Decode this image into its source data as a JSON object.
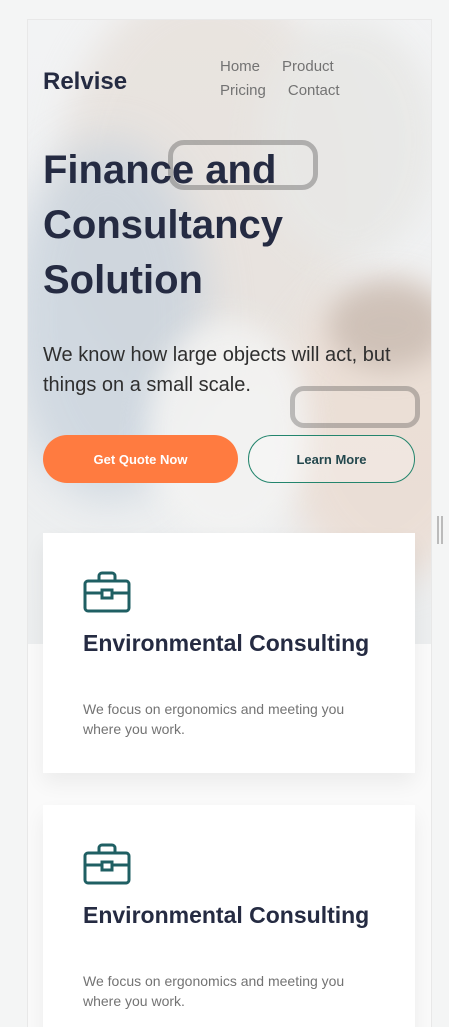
{
  "brand": {
    "logo": "Relvise"
  },
  "nav": {
    "items": [
      "Home",
      "Product",
      "Pricing",
      "Contact"
    ]
  },
  "hero": {
    "title": "Finance and Consultancy Solution",
    "subtitle": "We know how large objects will act, but things on a small scale.",
    "primary_button": "Get Quote Now",
    "secondary_button": "Learn More"
  },
  "cards": [
    {
      "icon": "briefcase-icon",
      "title": "Environmental Consulting",
      "text": "We focus on ergonomics and meeting you where you work."
    },
    {
      "icon": "briefcase-icon",
      "title": "Environmental Consulting",
      "text": "We focus on ergonomics and meeting you where you work."
    }
  ],
  "colors": {
    "accent": "#ff7b40",
    "heading": "#252b42",
    "teal": "#23856d",
    "muted": "#737373"
  }
}
